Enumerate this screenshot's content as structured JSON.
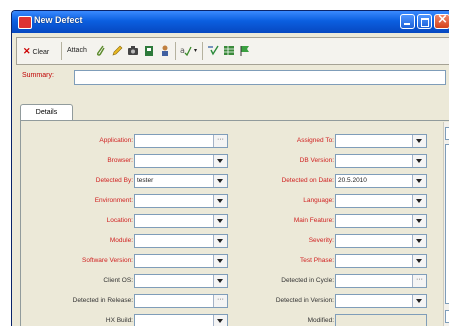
{
  "window": {
    "title": "New Defect"
  },
  "toolbar": {
    "clear_label": "Clear",
    "attach_label": "Attach"
  },
  "summary": {
    "label": "Summary:",
    "value": ""
  },
  "tabs": [
    {
      "label": "Details"
    }
  ],
  "left_fields": [
    {
      "label": "Application:",
      "required": true,
      "value": "",
      "control": "ellipsis"
    },
    {
      "label": "Browser:",
      "required": true,
      "value": "",
      "control": "dropdown"
    },
    {
      "label": "Detected By:",
      "required": true,
      "value": "tester",
      "control": "dropdown"
    },
    {
      "label": "Environment:",
      "required": true,
      "value": "",
      "control": "dropdown"
    },
    {
      "label": "Location:",
      "required": true,
      "value": "",
      "control": "dropdown"
    },
    {
      "label": "Module:",
      "required": true,
      "value": "",
      "control": "dropdown"
    },
    {
      "label": "Software Version:",
      "required": true,
      "value": "",
      "control": "dropdown"
    },
    {
      "label": "Client OS:",
      "required": false,
      "value": "",
      "control": "dropdown"
    },
    {
      "label": "Detected in Release:",
      "required": false,
      "value": "",
      "control": "ellipsis"
    },
    {
      "label": "HX Build:",
      "required": false,
      "value": "",
      "control": "dropdown"
    }
  ],
  "right_fields": [
    {
      "label": "Assigned To:",
      "required": true,
      "value": "",
      "control": "dropdown"
    },
    {
      "label": "DB Version:",
      "required": true,
      "value": "",
      "control": "dropdown"
    },
    {
      "label": "Detected on Date:",
      "required": true,
      "value": "20.5.2010",
      "control": "dropdown"
    },
    {
      "label": "Language:",
      "required": true,
      "value": "",
      "control": "dropdown"
    },
    {
      "label": "Main Feature:",
      "required": true,
      "value": "",
      "control": "dropdown"
    },
    {
      "label": "Severity:",
      "required": true,
      "value": "",
      "control": "dropdown"
    },
    {
      "label": "Test Phase:",
      "required": true,
      "value": "",
      "control": "dropdown"
    },
    {
      "label": "Detected in Cycle:",
      "required": false,
      "value": "",
      "control": "ellipsis"
    },
    {
      "label": "Detected in Version:",
      "required": false,
      "value": "",
      "control": "dropdown"
    },
    {
      "label": "Modified:",
      "required": false,
      "value": "",
      "control": "readonly"
    }
  ]
}
